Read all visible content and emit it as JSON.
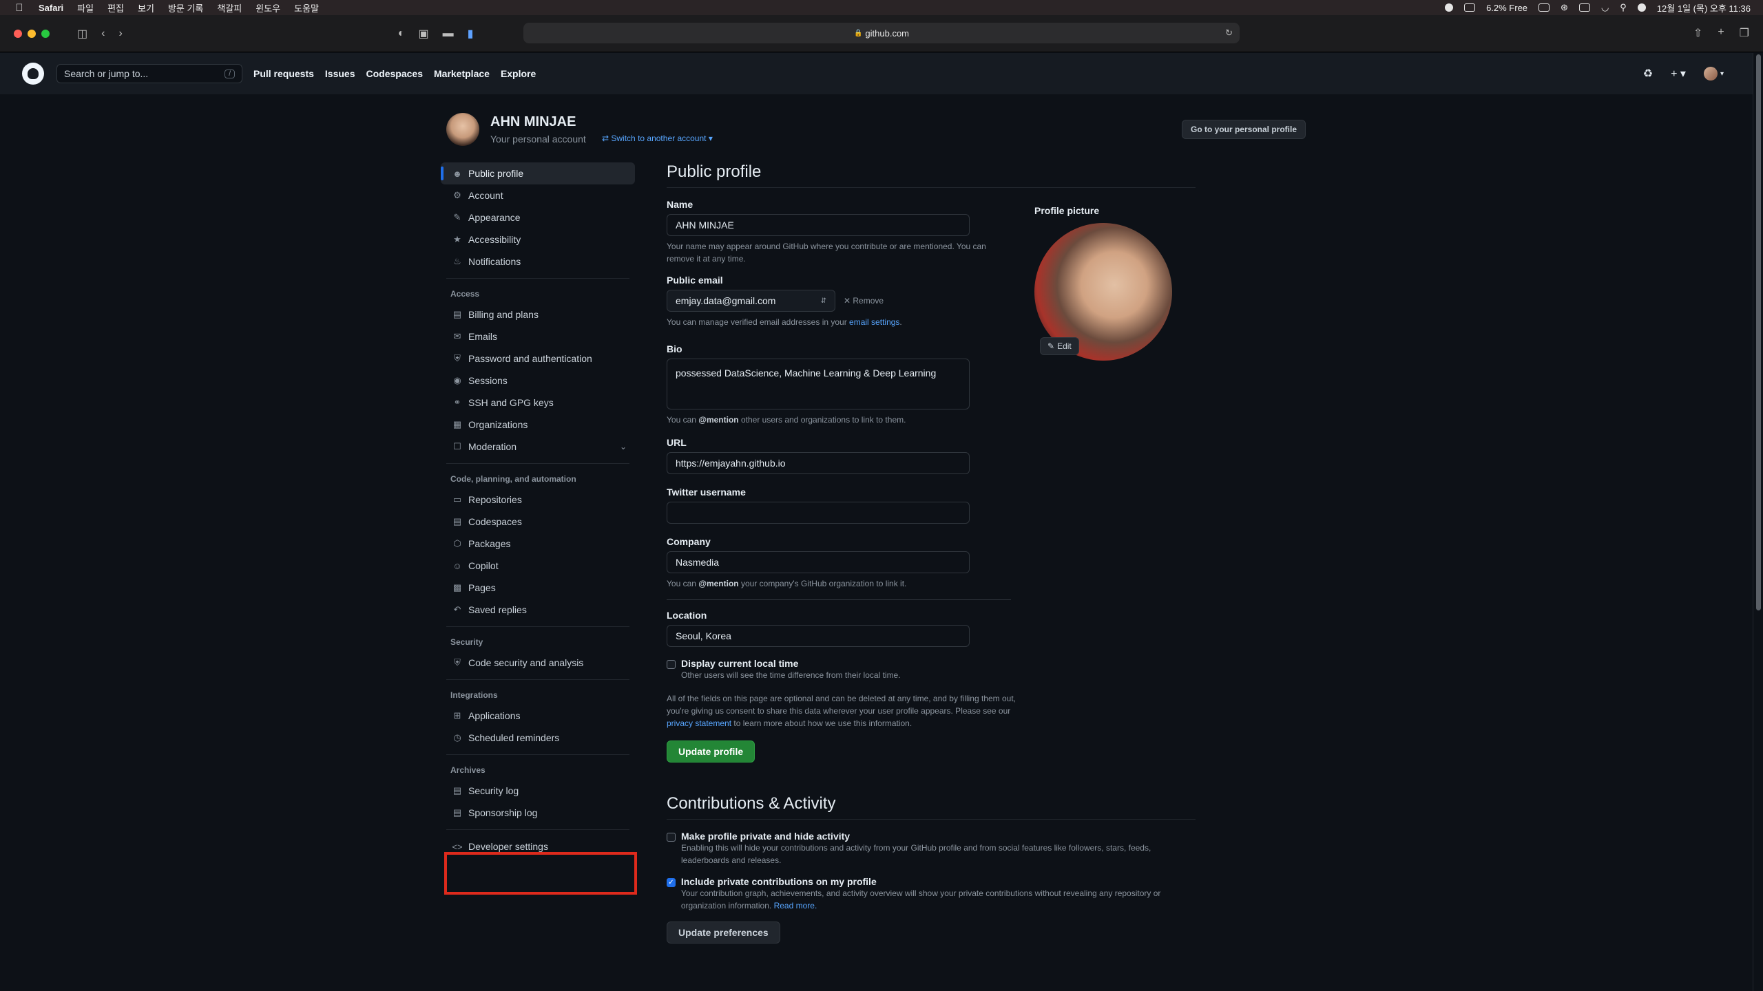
{
  "menubar": {
    "app": "Safari",
    "items": [
      "파일",
      "편집",
      "보기",
      "방문 기록",
      "책갈피",
      "윈도우",
      "도움말"
    ],
    "battery_text": "6.2% Free",
    "clock": "12월 1일 (목) 오후 11:36"
  },
  "browser": {
    "url": "github.com"
  },
  "gh_header": {
    "search_placeholder": "Search or jump to...",
    "search_shortcut": "/",
    "nav": [
      "Pull requests",
      "Issues",
      "Codespaces",
      "Marketplace",
      "Explore"
    ]
  },
  "account": {
    "name": "AHN MINJAE",
    "subtitle": "Your personal account",
    "switch_label": "Switch to another account",
    "goto_label": "Go to your personal profile"
  },
  "sidebar": {
    "top": [
      "Public profile",
      "Account",
      "Appearance",
      "Accessibility",
      "Notifications"
    ],
    "access_head": "Access",
    "access": [
      "Billing and plans",
      "Emails",
      "Password and authentication",
      "Sessions",
      "SSH and GPG keys",
      "Organizations",
      "Moderation"
    ],
    "code_head": "Code, planning, and automation",
    "code": [
      "Repositories",
      "Codespaces",
      "Packages",
      "Copilot",
      "Pages",
      "Saved replies"
    ],
    "security_head": "Security",
    "security": [
      "Code security and analysis"
    ],
    "integrations_head": "Integrations",
    "integrations": [
      "Applications",
      "Scheduled reminders"
    ],
    "archives_head": "Archives",
    "archives": [
      "Security log",
      "Sponsorship log"
    ],
    "developer": "Developer settings"
  },
  "profile": {
    "title": "Public profile",
    "name_label": "Name",
    "name_value": "AHN MINJAE",
    "name_note": "Your name may appear around GitHub where you contribute or are mentioned. You can remove it at any time.",
    "email_label": "Public email",
    "email_value": "emjay.data@gmail.com",
    "remove_label": "Remove",
    "email_note_pre": "You can manage verified email addresses in your ",
    "email_note_link": "email settings",
    "email_note_post": ".",
    "bio_label": "Bio",
    "bio_value": "possessed DataScience, Machine Learning & Deep Learning",
    "bio_note_pre": "You can ",
    "bio_note_mention": "@mention",
    "bio_note_post": " other users and organizations to link to them.",
    "url_label": "URL",
    "url_value": "https://emjayahn.github.io",
    "twitter_label": "Twitter username",
    "twitter_value": "",
    "company_label": "Company",
    "company_value": "Nasmedia",
    "company_note_pre": "You can ",
    "company_note_mention": "@mention",
    "company_note_post": " your company's GitHub organization to link it.",
    "location_label": "Location",
    "location_value": "Seoul, Korea",
    "localtime_label": "Display current local time",
    "localtime_desc": "Other users will see the time difference from their local time.",
    "consent_pre": "All of the fields on this page are optional and can be deleted at any time, and by filling them out, you're giving us consent to share this data wherever your user profile appears. Please see our ",
    "consent_link": "privacy statement",
    "consent_post": " to learn more about how we use this information.",
    "update_button": "Update profile",
    "picture_label": "Profile picture",
    "edit_label": "Edit"
  },
  "contrib": {
    "title": "Contributions & Activity",
    "private_label": "Make profile private and hide activity",
    "private_desc": "Enabling this will hide your contributions and activity from your GitHub profile and from social features like followers, stars, feeds, leaderboards and releases.",
    "private_checked": false,
    "include_label": "Include private contributions on my profile",
    "include_desc": "Your contribution graph, achievements, and activity overview will show your private contributions without revealing any repository or organization information.",
    "include_link": "Read more.",
    "include_checked": true,
    "update_button": "Update preferences"
  },
  "colors": {
    "accent": "#1f6feb",
    "link": "#58a6ff",
    "primary_button": "#238636",
    "highlight_box": "#dd2a1c"
  }
}
